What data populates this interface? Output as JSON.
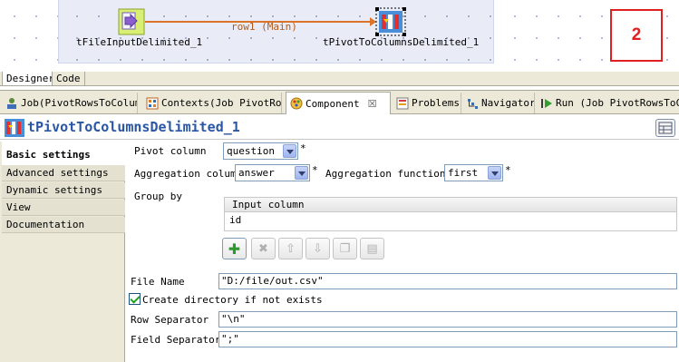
{
  "designer": {
    "input_component": "tFileInputDelimited_1",
    "output_component": "tPivotToColumnsDelimited_1",
    "connection_label": "row1 (Main)",
    "note_number": "2"
  },
  "editor_tabs": {
    "designer": "Designer",
    "code": "Code"
  },
  "view_tabs": [
    {
      "label": "Job(PivotRowsToColumn",
      "icon": "job-icon"
    },
    {
      "label": "Contexts(Job PivotRow",
      "icon": "contexts-icon"
    },
    {
      "label": "Component",
      "icon": "component-icon",
      "close": "☒"
    },
    {
      "label": "Problems",
      "icon": "problems-icon"
    },
    {
      "label": "Navigator",
      "icon": "navigator-icon"
    },
    {
      "label": "Run (Job PivotRowsToC",
      "icon": "run-icon"
    }
  ],
  "component": {
    "title": "tPivotToColumnsDelimited_1"
  },
  "side_tabs": [
    "Basic settings",
    "Advanced settings",
    "Dynamic settings",
    "View",
    "Documentation"
  ],
  "settings": {
    "pivot_column_label": "Pivot column",
    "pivot_column_value": "question",
    "aggregation_column_label": "Aggregation column",
    "aggregation_column_value": "answer",
    "aggregation_function_label": "Aggregation function",
    "aggregation_function_value": "first",
    "required_mark": "*",
    "group_by_label": "Group by",
    "group_by_header": "Input column",
    "group_by_rows": [
      "id"
    ],
    "file_name_label": "File Name",
    "file_name_value": "\"D:/file/out.csv\"",
    "create_dir_label": "Create directory if not exists",
    "create_dir_checked": true,
    "row_separator_label": "Row Separator",
    "row_separator_value": "\"\\n\"",
    "field_separator_label": "Field Separator",
    "field_separator_value": "\";\""
  },
  "colors": {
    "title_blue": "#2956a5",
    "connection_orange": "#d9742a",
    "note_red": "#e02020"
  }
}
